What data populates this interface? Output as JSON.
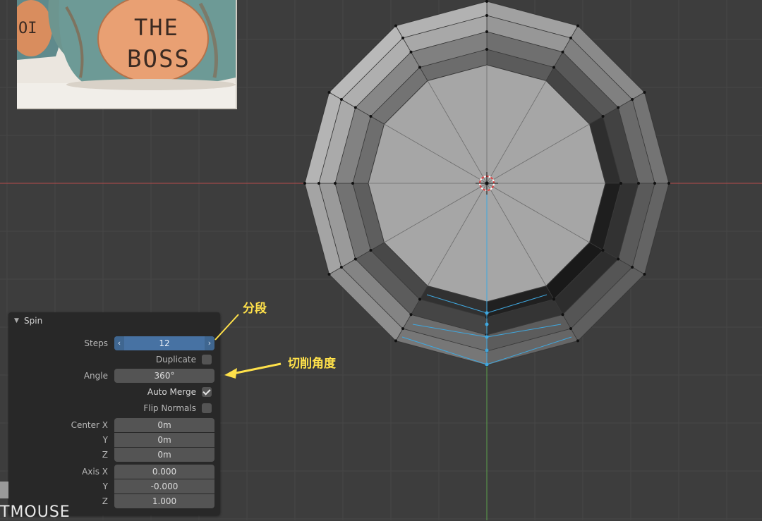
{
  "reference_image": {
    "mug_text_line1": "THE",
    "mug_text_line2": "BOSS",
    "mug_left_fragment": "OI"
  },
  "viewport": {
    "grid_color": "#464646",
    "background": "#3d3d3d",
    "x_axis_color": "#b74c4c",
    "y_axis_color": "#5aa04a",
    "selection_color": "#3fa8e0"
  },
  "spin_panel": {
    "title": "Spin",
    "steps": {
      "label": "Steps",
      "value": "12",
      "left_arrow": "‹",
      "right_arrow": "›"
    },
    "duplicate": {
      "label": "Duplicate",
      "checked": false
    },
    "angle": {
      "label": "Angle",
      "value": "360°"
    },
    "auto_merge": {
      "label": "Auto Merge",
      "checked": true
    },
    "flip_normals": {
      "label": "Flip Normals",
      "checked": false
    },
    "center": {
      "x_label": "Center X",
      "x_value": "0m",
      "y_label": "Y",
      "y_value": "0m",
      "z_label": "Z",
      "z_value": "0m"
    },
    "axis": {
      "x_label": "Axis X",
      "x_value": "0.000",
      "y_label": "Y",
      "y_value": "-0.000",
      "z_label": "Z",
      "z_value": "1.000"
    }
  },
  "annotations": {
    "steps_note": "分段",
    "angle_note": "切削角度",
    "color": "#ffe14a"
  },
  "overlay": {
    "mouse_hint": "TMOUSE"
  }
}
